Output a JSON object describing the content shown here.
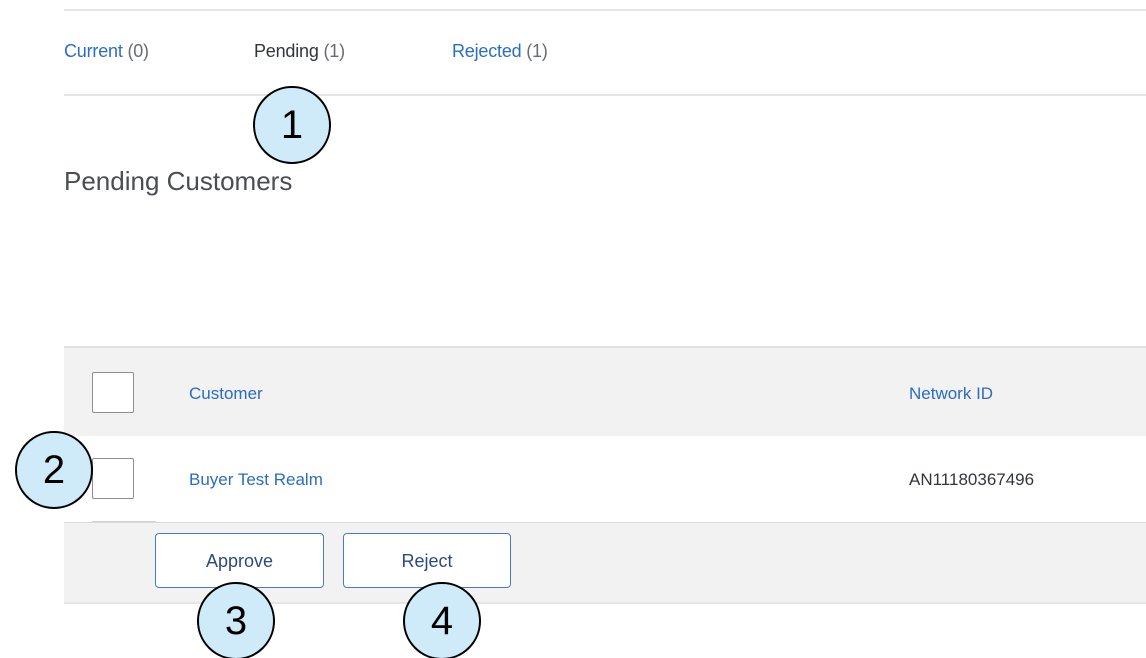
{
  "tabs": [
    {
      "label": "Current",
      "count": "(0)"
    },
    {
      "label": "Pending",
      "count": "(1)"
    },
    {
      "label": "Rejected",
      "count": "(1)"
    }
  ],
  "page_title": "Pending Customers",
  "table": {
    "columns": [
      "Customer",
      "Network ID"
    ],
    "rows": [
      {
        "customer": "Buyer Test Realm",
        "network_id": "AN11180367496"
      }
    ]
  },
  "actions": {
    "approve_label": "Approve",
    "reject_label": "Reject"
  },
  "callouts": [
    "1",
    "2",
    "3",
    "4"
  ],
  "colors": {
    "link": "#2b6cc4",
    "callout_fill": "#cfeaf9",
    "header_bg": "#f2f2f2"
  }
}
